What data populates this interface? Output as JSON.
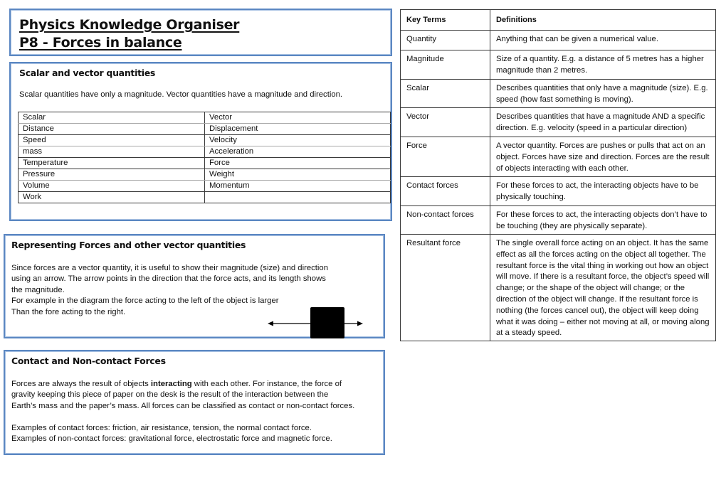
{
  "header": {
    "title_line1": "Physics Knowledge Organiser",
    "title_line2": "P8 - Forces in balance"
  },
  "scalar_vector": {
    "heading": "Scalar and vector quantities",
    "intro": "Scalar quantities have only a magnitude. Vector quantities have a magnitude and direction.",
    "table": {
      "headers": [
        "Scalar",
        "Vector"
      ],
      "rows": [
        [
          "Distance",
          "Displacement"
        ],
        [
          "Speed",
          "Velocity"
        ],
        [
          "mass",
          "Acceleration"
        ],
        [
          "Temperature",
          "Force"
        ],
        [
          "Pressure",
          "Weight"
        ],
        [
          "Volume",
          "Momentum"
        ],
        [
          "Work",
          ""
        ]
      ]
    }
  },
  "representing": {
    "heading": "Representing Forces and other vector quantities",
    "lines": [
      "Since forces are a vector quantity, it is useful to show their magnitude (size) and direction",
      "using an arrow. The arrow points in the direction that the force acts, and its length shows",
      "the magnitude.",
      "For example in the diagram the force acting to the left of the object is larger",
      "Than the fore acting to the right."
    ],
    "diagram": {
      "object_color": "#000000",
      "left_arrow": "larger force to the left",
      "right_arrow": "smaller force to the right"
    }
  },
  "contact": {
    "heading": "Contact and Non-contact Forces",
    "para1_before_bold": "Forces are always the result of objects ",
    "para1_bold": "interacting",
    "para1_after_bold": " with each other. For instance, the force of",
    "para1_line2": "gravity keeping this piece of paper on the desk is the result of the interaction between the",
    "para1_line3": "Earth’s mass and the paper’s mass. All forces can be classified as contact or non-contact forces.",
    "examples_contact": "Examples of contact forces: friction, air resistance, tension, the normal contact force.",
    "examples_noncontact": "Examples of non-contact forces: gravitational force, electrostatic force and magnetic force."
  },
  "key_terms": {
    "headers": [
      "Key Terms",
      "Definitions"
    ],
    "rows": [
      {
        "term": "Quantity",
        "definition": "Anything that can be given a numerical value."
      },
      {
        "term": "Magnitude",
        "definition": "Size of a quantity. E.g. a distance of 5 metres has a higher magnitude than 2 metres."
      },
      {
        "term": "Scalar",
        "definition": "Describes quantities that only have a magnitude (size). E.g. speed (how fast something is moving)."
      },
      {
        "term": "Vector",
        "definition": "Describes quantities that have a magnitude AND a specific direction. E.g. velocity (speed in a particular direction)"
      },
      {
        "term": "Force",
        "definition": "A vector quantity. Forces are pushes or pulls that act on an object. Forces have size and direction. Forces are the result of objects interacting with each other."
      },
      {
        "term": "Contact forces",
        "definition": "For these forces to act, the interacting objects have to be physically touching."
      },
      {
        "term": "Non-contact forces",
        "definition": "For these forces to act, the interacting objects don’t have to be touching (they are physically separate)."
      },
      {
        "term": "Resultant force",
        "definition": "The single overall force acting on an object. It has the same effect as all the forces acting on the object all together. The resultant force is the vital thing in working out how an object will move. If there is a resultant force, the object’s speed will change; or the shape of the object will change; or the direction of the object will change. If the resultant force is nothing (the forces cancel out), the object will keep doing what it was doing – either not moving at all, or moving along at a steady speed."
      }
    ]
  },
  "colors": {
    "panel_border": "#5b87c2",
    "table_border": "#3a3a3a"
  }
}
